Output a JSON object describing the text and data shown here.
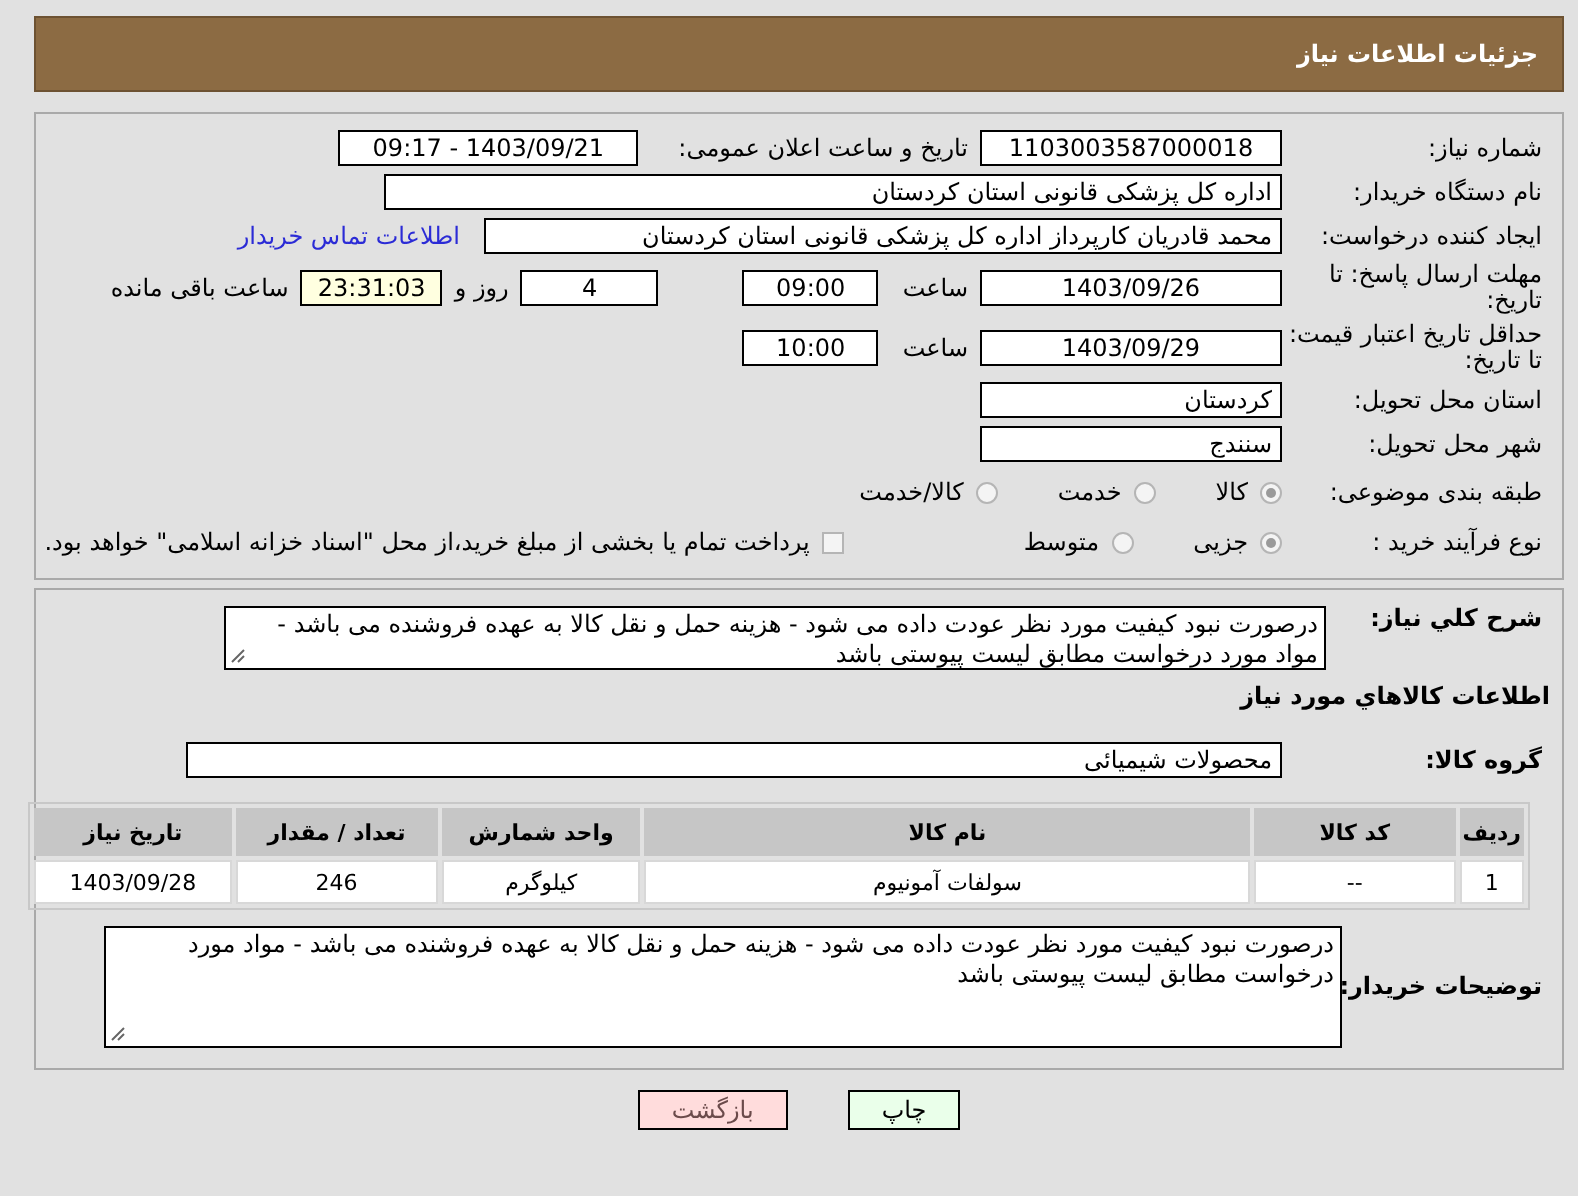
{
  "header": {
    "title": "جزئیات اطلاعات نیاز"
  },
  "need_number": {
    "label": "شماره نیاز:",
    "value": "1103003587000018"
  },
  "announce": {
    "label": "تاریخ و ساعت اعلان عمومی:",
    "value": "1403/09/21 - 09:17"
  },
  "buyer_org": {
    "label": "نام دستگاه خریدار:",
    "value": "اداره کل پزشکی قانونی استان کردستان"
  },
  "requester": {
    "label": "ایجاد کننده درخواست:",
    "value": "محمد قادریان کارپرداز اداره کل پزشکی قانونی استان کردستان",
    "link": "اطلاعات تماس خریدار"
  },
  "reply_deadline": {
    "label": "مهلت ارسال پاسخ: تا تاریخ:",
    "date": "1403/09/26",
    "time_label": "ساعت",
    "time": "09:00",
    "days": "4",
    "days_label": "روز و",
    "remaining": "23:31:03",
    "remaining_label": "ساعت باقی مانده"
  },
  "price_validity": {
    "label": "حداقل تاریخ اعتبار قیمت: تا تاریخ:",
    "date": "1403/09/29",
    "time_label": "ساعت",
    "time": "10:00"
  },
  "province": {
    "label": "استان محل تحویل:",
    "value": "کردستان"
  },
  "city": {
    "label": "شهر محل تحویل:",
    "value": "سنندج"
  },
  "category": {
    "label": "طبقه بندی موضوعی:",
    "options": [
      {
        "label": "کالا",
        "selected": true
      },
      {
        "label": "خدمت",
        "selected": false
      },
      {
        "label": "کالا/خدمت",
        "selected": false
      }
    ]
  },
  "process": {
    "label": "نوع فرآیند خرید :",
    "options": [
      {
        "label": "جزیی",
        "selected": true
      },
      {
        "label": "متوسط",
        "selected": false
      }
    ],
    "treasury": {
      "label": "پرداخت تمام یا بخشی از مبلغ خرید،از محل \"اسناد خزانه اسلامی\" خواهد بود.",
      "checked": false
    }
  },
  "description": {
    "label": "شرح کلي نياز:",
    "value": "درصورت نبود کیفیت مورد نظر عودت داده می شود - هزینه حمل و نقل کالا به عهده فروشنده می باشد - مواد مورد درخواست مطابق لیست پیوستی باشد"
  },
  "goods_heading": "اطلاعات کالاهاي مورد نياز",
  "goods_group": {
    "label": "گروه کالا:",
    "value": "محصولات شیمیائی"
  },
  "table": {
    "columns": [
      "ردیف",
      "کد کالا",
      "نام کالا",
      "واحد شمارش",
      "تعداد / مقدار",
      "تاریخ نیاز"
    ],
    "rows": [
      [
        "1",
        "--",
        "سولفات آمونیوم",
        "کیلوگرم",
        "246",
        "1403/09/28"
      ]
    ]
  },
  "buyer_notes": {
    "label": "توضیحات خریدار:",
    "value": "درصورت نبود کیفیت مورد نظر عودت داده می شود - هزینه حمل و نقل کالا به عهده فروشنده می باشد - مواد مورد درخواست مطابق لیست پیوستی باشد"
  },
  "buttons": [
    {
      "label": "چاپ",
      "kind": "print"
    },
    {
      "label": "بازگشت",
      "kind": "back"
    }
  ]
}
